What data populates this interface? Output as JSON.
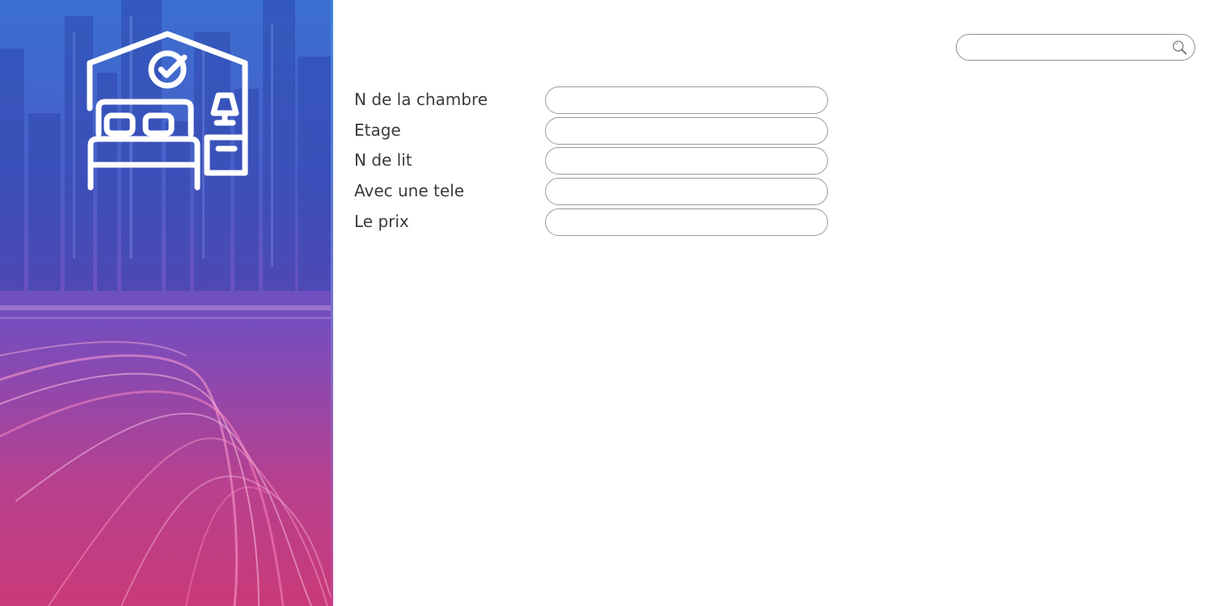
{
  "sidebar": {
    "hero_icon": "room-bed-nightstand-check-icon",
    "colors": {
      "top": "#3a6fd0",
      "middle": "#7a4cbc",
      "bottom": "#c93a78"
    }
  },
  "search": {
    "value": "",
    "placeholder": "",
    "icon": "search-icon"
  },
  "form": {
    "fields": [
      {
        "label": "N de la chambre",
        "value": ""
      },
      {
        "label": "Etage",
        "value": ""
      },
      {
        "label": "N de lit",
        "value": ""
      },
      {
        "label": "Avec une tele",
        "value": ""
      },
      {
        "label": "Le prix",
        "value": ""
      }
    ]
  }
}
